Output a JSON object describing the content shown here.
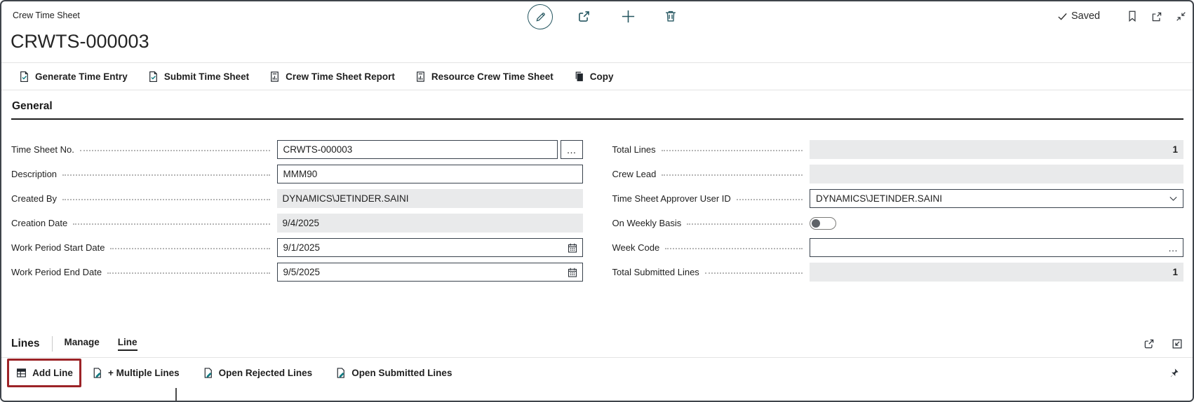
{
  "window": {
    "caption": "Crew Time Sheet",
    "title": "CRWTS-000003",
    "saved_label": "Saved"
  },
  "header_icons": [
    "edit-pencil-icon",
    "share-icon",
    "new-plus-icon",
    "delete-trash-icon",
    "saved-check-icon",
    "bookmark-icon",
    "open-window-icon",
    "collapse-icon"
  ],
  "command_bar": {
    "items": [
      {
        "label": "Generate Time Entry",
        "icon": "document-check-icon"
      },
      {
        "label": "Submit Time Sheet",
        "icon": "document-check-icon"
      },
      {
        "label": "Crew Time Sheet Report",
        "icon": "report-icon"
      },
      {
        "label": "Resource Crew Time Sheet",
        "icon": "report-icon"
      },
      {
        "label": "Copy",
        "icon": "copy-icon"
      }
    ]
  },
  "general": {
    "heading": "General",
    "left_fields": [
      {
        "label": "Time Sheet No.",
        "value": "CRWTS-000003",
        "control": "input-with-assist"
      },
      {
        "label": "Description",
        "value": "MMM90",
        "control": "input"
      },
      {
        "label": "Created By",
        "value": "DYNAMICS\\JETINDER.SAINI",
        "control": "disabled"
      },
      {
        "label": "Creation Date",
        "value": "9/4/2025",
        "control": "disabled"
      },
      {
        "label": "Work Period Start Date",
        "value": "9/1/2025",
        "control": "date-input"
      },
      {
        "label": "Work Period End Date",
        "value": "9/5/2025",
        "control": "date-input"
      }
    ],
    "right_fields": [
      {
        "label": "Total Lines",
        "value": "1",
        "control": "disabled-number"
      },
      {
        "label": "Crew Lead",
        "value": "",
        "control": "disabled"
      },
      {
        "label": "Time Sheet Approver User ID",
        "value": "DYNAMICS\\JETINDER.SAINI",
        "control": "dropdown-input"
      },
      {
        "label": "On Weekly Basis",
        "value": "off",
        "control": "toggle"
      },
      {
        "label": "Week Code",
        "value": "",
        "control": "input-with-ellipsis"
      },
      {
        "label": "Total Submitted Lines",
        "value": "1",
        "control": "disabled-number"
      }
    ]
  },
  "lines": {
    "heading": "Lines",
    "tabs": [
      {
        "label": "Manage",
        "active": false
      },
      {
        "label": "Line",
        "active": true
      }
    ],
    "actions": [
      {
        "label": "Add Line",
        "icon": "add-line-grid-icon",
        "highlighted": true
      },
      {
        "label": "+ Multiple Lines",
        "icon": "page-edit-icon"
      },
      {
        "label": "Open Rejected Lines",
        "icon": "page-edit-icon"
      },
      {
        "label": "Open Submitted Lines",
        "icon": "page-edit-icon"
      }
    ],
    "header_icons": [
      "share-icon",
      "expand-icon"
    ],
    "footer_icon": "pin-icon"
  },
  "glyphs": {
    "ellipsis": "…"
  },
  "colors": {
    "accent_teal": "#255660",
    "check_teal": "#0f7b82",
    "highlight_red": "#9c2327",
    "disabled_bg": "#e9eaeb",
    "input_border": "#39424d"
  }
}
